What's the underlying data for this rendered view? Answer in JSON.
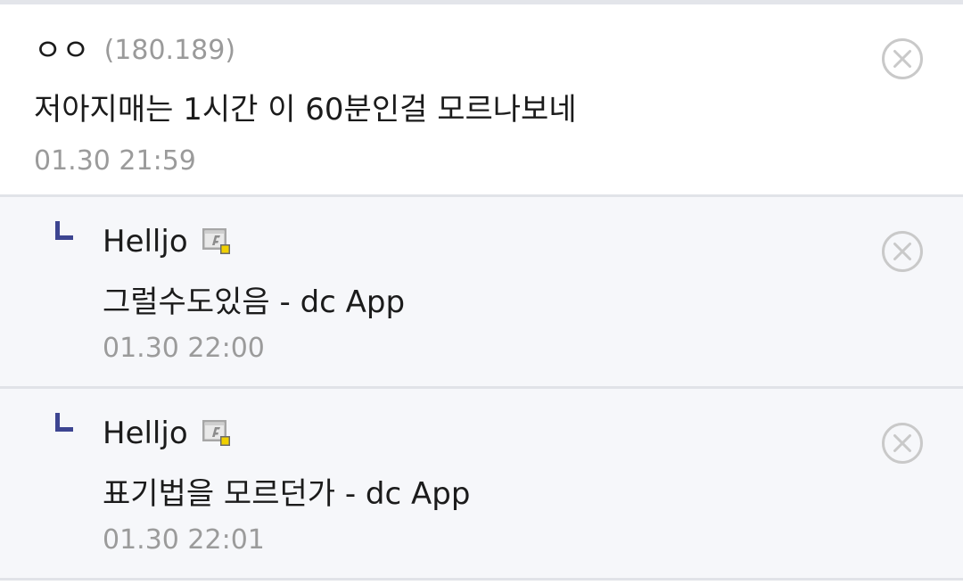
{
  "comments": [
    {
      "author": "ㅇㅇ",
      "ip": "(180.189)",
      "text": "저아지매는 1시간 이 60분인걸 모르나보네",
      "time": "01.30 21:59"
    },
    {
      "author": "Helljo",
      "text": "그럴수도있음 - dc App",
      "time": "01.30 22:00"
    },
    {
      "author": "Helljo",
      "text": "표기법을 모르던가 - dc App",
      "time": "01.30 22:01"
    }
  ],
  "icons": {
    "delete": "circle-x-icon",
    "reply": "reply-indent-icon",
    "gallog": "gallog-fixed-nick-icon"
  },
  "colors": {
    "reply_marker": "#3d4591",
    "reply_background": "#f6f7fa",
    "divider": "#e1e3e8",
    "meta_text": "#9b9b9b",
    "gallog_badge": "#f0d000"
  }
}
